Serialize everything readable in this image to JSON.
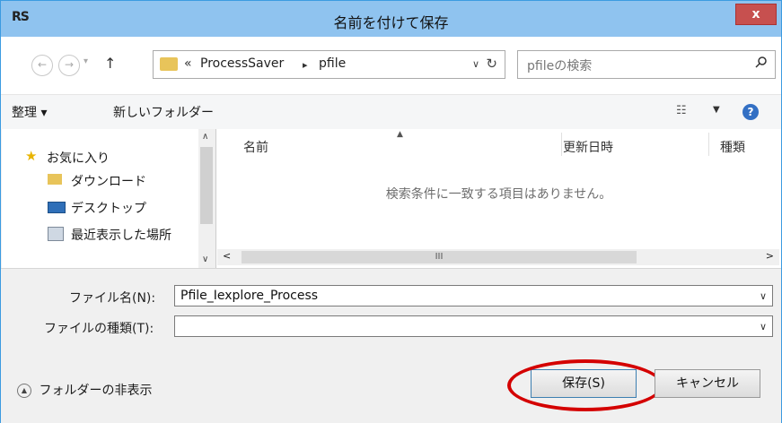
{
  "window": {
    "title": "名前を付けて保存",
    "app_icon": "RS",
    "close_label": "x"
  },
  "navigation": {
    "back_icon": "back-arrow-icon",
    "forward_icon": "forward-arrow-icon",
    "up_icon": "up-arrow-icon",
    "breadcrumb_prefix": "«",
    "breadcrumb": [
      "ProcessSaver",
      "pfile"
    ],
    "breadcrumb_separator": "▸",
    "search_placeholder": "pfileの検索"
  },
  "toolbar": {
    "organize": "整理 ▾",
    "new_folder": "新しいフォルダー"
  },
  "sidebar": {
    "items": [
      {
        "label": "お気に入り",
        "icon": "star-icon"
      },
      {
        "label": "ダウンロード",
        "icon": "download-folder-icon"
      },
      {
        "label": "デスクトップ",
        "icon": "desktop-icon"
      },
      {
        "label": "最近表示した場所",
        "icon": "recent-places-icon"
      }
    ]
  },
  "file_list": {
    "columns": [
      "名前",
      "更新日時",
      "種類"
    ],
    "empty_message": "検索条件に一致する項目はありません。",
    "scroll_grip": "III"
  },
  "form": {
    "filename_label": "ファイル名(N):",
    "filename_value": "Pfile_Iexplore_Process",
    "filetype_label": "ファイルの種類(T):",
    "filetype_value": "",
    "hide_folders": "フォルダーの非表示",
    "save_button": "保存(S)",
    "cancel_button": "キャンセル"
  },
  "colors": {
    "titlebar": "#8fc3ef",
    "highlight": "#d40000"
  }
}
